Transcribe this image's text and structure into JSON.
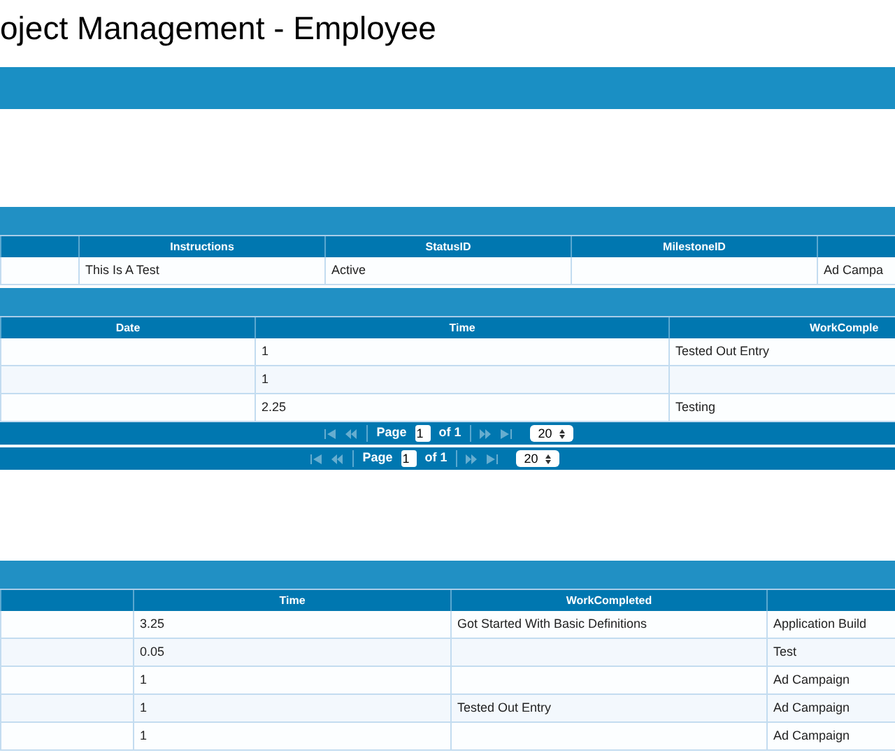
{
  "title": "oject Management - Employee",
  "grids": [
    {
      "columns": [
        null,
        "Instructions",
        "StatusID",
        "MilestoneID",
        null
      ],
      "rows": [
        [
          null,
          "This Is A Test",
          "Active",
          null,
          "Ad Campa"
        ]
      ]
    },
    {
      "columns": [
        "Date",
        "Time",
        "WorkComple"
      ],
      "rows": [
        [
          null,
          "1",
          "Tested Out Entry"
        ],
        [
          null,
          "1",
          null
        ],
        [
          null,
          "2.25",
          "Testing"
        ]
      ],
      "pagers": [
        {
          "page_label": "Page",
          "page": "1",
          "of_label": "of 1",
          "page_size": "20",
          "nav_disabled": true
        },
        {
          "page_label": "Page",
          "page": "1",
          "of_label": "of 1",
          "page_size": "20",
          "nav_disabled": true
        }
      ]
    },
    {
      "columns": [
        null,
        "Time",
        "WorkCompleted",
        null
      ],
      "rows": [
        [
          null,
          "3.25",
          "Got Started With Basic Definitions",
          "Application Build"
        ],
        [
          null,
          "0.05",
          null,
          "Test"
        ],
        [
          null,
          "1",
          null,
          "Ad Campaign"
        ],
        [
          null,
          "1",
          "Tested Out Entry",
          "Ad Campaign"
        ],
        [
          null,
          "1",
          null,
          "Ad Campaign"
        ]
      ]
    }
  ]
}
